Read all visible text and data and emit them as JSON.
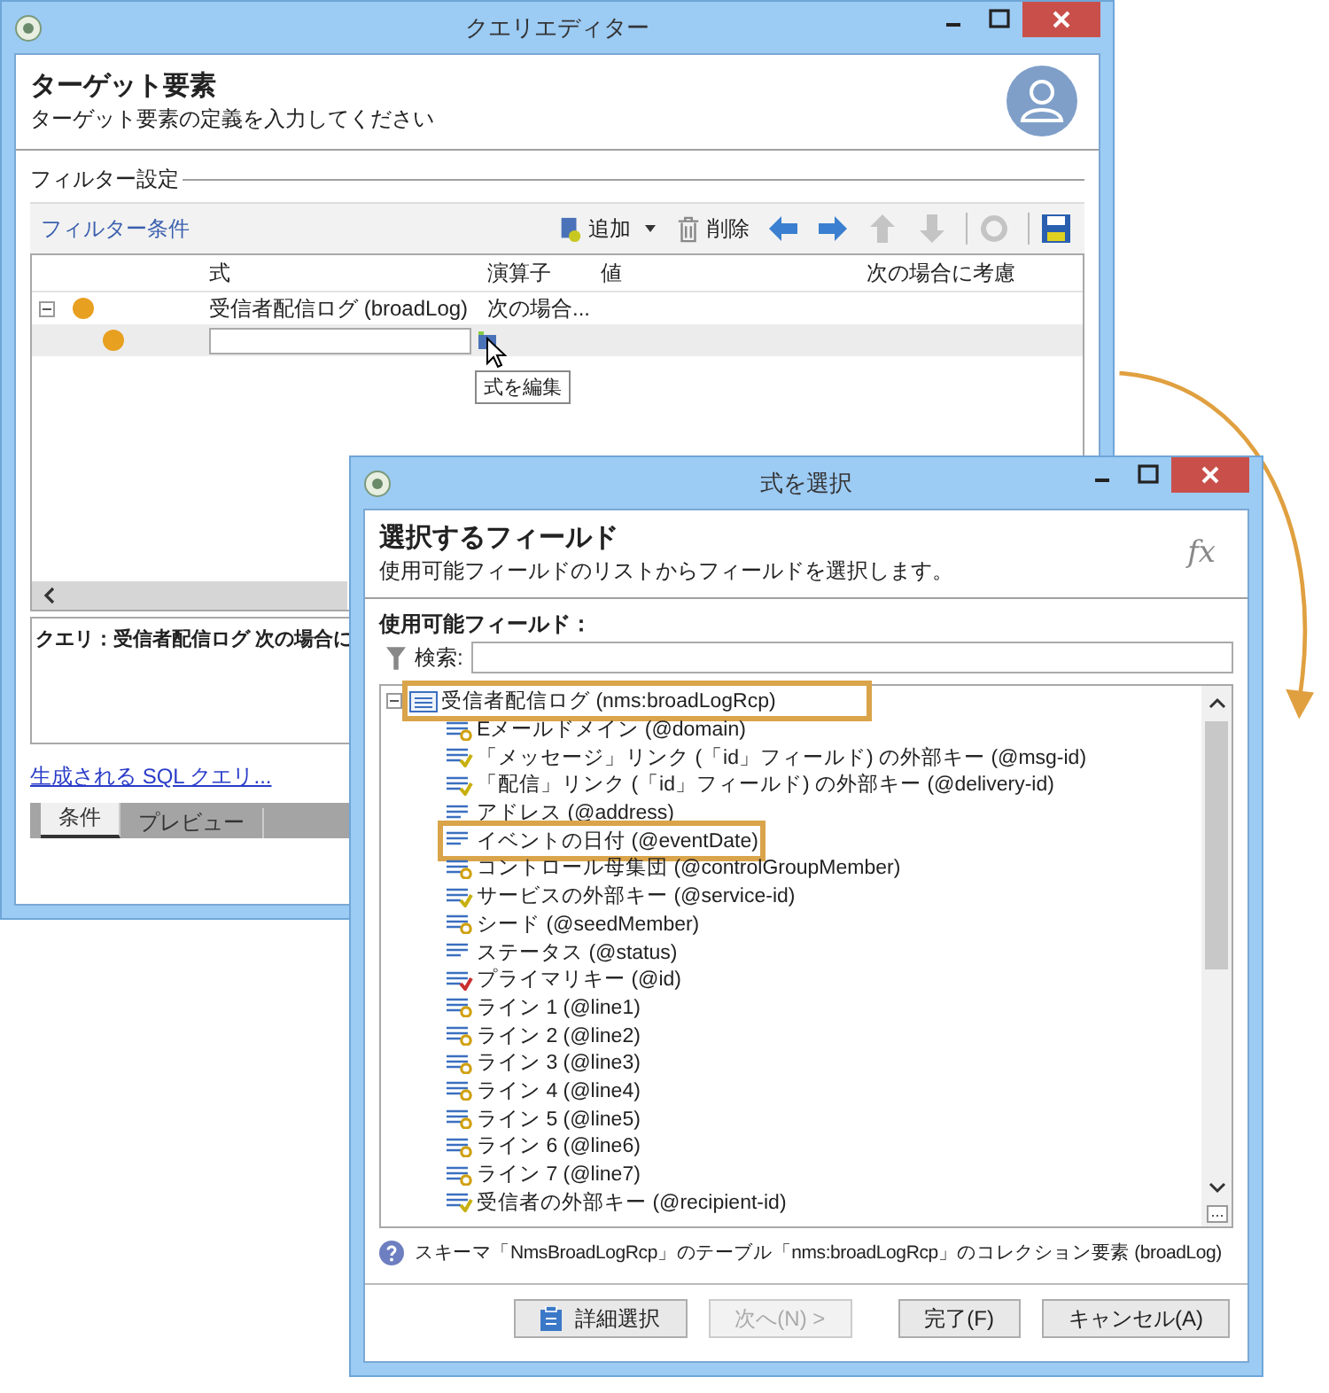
{
  "main_window": {
    "title": "クエリエディター",
    "header": {
      "title": "ターゲット要素",
      "subtitle": "ターゲット要素の定義を入力してください"
    },
    "group_label": "フィルター設定",
    "toolbar": {
      "link": "フィルター条件",
      "buttons": [
        {
          "kind": "add",
          "label": "追加",
          "disabled": false
        },
        {
          "kind": "delete",
          "label": "削除",
          "disabled": false
        },
        {
          "kind": "left",
          "disabled": false
        },
        {
          "kind": "right",
          "disabled": false
        },
        {
          "kind": "up",
          "disabled": true
        },
        {
          "kind": "down",
          "disabled": true
        },
        {
          "kind": "refresh",
          "disabled": true
        },
        {
          "kind": "save",
          "disabled": false
        }
      ]
    },
    "table": {
      "columns": [
        "式",
        "演算子",
        "値",
        "次の場合に考慮"
      ],
      "rows": [
        {
          "expanded": true,
          "selected": false,
          "color": "#e8a020",
          "expression": "受信者配信ログ (broadLog)",
          "operator": "次の場合...",
          "children": [
            {
              "selected": true,
              "color": "#e8a020",
              "editing": true
            }
          ]
        }
      ]
    },
    "tooltip": "式を編集",
    "query": "クエリ：受信者配信ログ 次の場合に",
    "sql_link": "生成される SQL クエリ...",
    "tabs": [
      {
        "label": "条件",
        "selected": true
      },
      {
        "label": "プレビュー",
        "selected": false
      }
    ]
  },
  "dialog": {
    "title": "式を選択",
    "header": {
      "title": "選択するフィールド",
      "subtitle": "使用可能フィールドのリストからフィールドを選択します。",
      "icon_text": "fx"
    },
    "fields_label": "使用可能フィールド：",
    "search": {
      "label": "検索:"
    },
    "tree": {
      "label": "受信者配信ログ (nms:broadLogRcp)",
      "highlighted": true,
      "expanded": true,
      "children": [
        {
          "kind": "enum",
          "label": "Eメールドメイン (@domain)",
          "highlighted": false
        },
        {
          "kind": "link",
          "label": "「メッセージ」リンク (「id」フィールド) の外部キー (@msg-id)",
          "highlighted": false
        },
        {
          "kind": "link",
          "label": "「配信」リンク (「id」フィールド) の外部キー (@delivery-id)",
          "highlighted": false
        },
        {
          "kind": "text",
          "label": "アドレス (@address)",
          "highlighted": false
        },
        {
          "kind": "text",
          "label": "イベントの日付 (@eventDate)",
          "highlighted": true
        },
        {
          "kind": "enum",
          "label": "コントロール母集団 (@controlGroupMember)",
          "highlighted": false
        },
        {
          "kind": "link",
          "label": "サービスの外部キー (@service-id)",
          "highlighted": false
        },
        {
          "kind": "enum",
          "label": "シード (@seedMember)",
          "highlighted": false
        },
        {
          "kind": "text",
          "label": "ステータス (@status)",
          "highlighted": false
        },
        {
          "kind": "key",
          "label": "プライマリキー (@id)",
          "highlighted": false
        },
        {
          "kind": "enum",
          "label": "ライン 1 (@line1)",
          "highlighted": false
        },
        {
          "kind": "enum",
          "label": "ライン 2 (@line2)",
          "highlighted": false
        },
        {
          "kind": "enum",
          "label": "ライン 3 (@line3)",
          "highlighted": false
        },
        {
          "kind": "enum",
          "label": "ライン 4 (@line4)",
          "highlighted": false
        },
        {
          "kind": "enum",
          "label": "ライン 5 (@line5)",
          "highlighted": false
        },
        {
          "kind": "enum",
          "label": "ライン 6 (@line6)",
          "highlighted": false
        },
        {
          "kind": "enum",
          "label": "ライン 7 (@line7)",
          "highlighted": false
        },
        {
          "kind": "link",
          "label": "受信者の外部キー (@recipient-id)",
          "highlighted": false
        }
      ]
    },
    "info": "スキーマ「NmsBroadLogRcp」のテーブル「nms:broadLogRcp」のコレクション要素 (broadLog)",
    "buttons": [
      {
        "kind": "advanced",
        "label": "詳細選択",
        "disabled": false
      },
      {
        "kind": "plain",
        "label": "次へ(N) >",
        "disabled": true
      },
      {
        "kind": "plain",
        "label": "完了(F)",
        "disabled": false
      },
      {
        "kind": "plain",
        "label": "キャンセル(A)",
        "disabled": false
      }
    ]
  }
}
